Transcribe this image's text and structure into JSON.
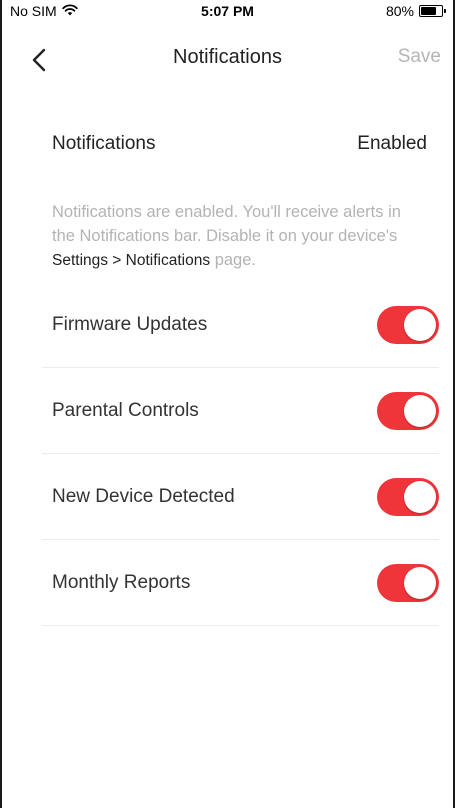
{
  "status_bar": {
    "carrier": "No SIM",
    "time": "5:07 PM",
    "battery_text": "80%",
    "battery_level": 0.8
  },
  "nav": {
    "title": "Notifications",
    "save_label": "Save"
  },
  "summary": {
    "label": "Notifications",
    "value": "Enabled"
  },
  "info": {
    "text_before": "Notifications are enabled. You'll receive alerts in the Notifications bar. Disable it on your device's",
    "path": "Settings > Notifications",
    "text_after": "page."
  },
  "settings": [
    {
      "label": "Firmware Updates",
      "enabled": true
    },
    {
      "label": "Parental Controls",
      "enabled": true
    },
    {
      "label": "New Device Detected",
      "enabled": true
    },
    {
      "label": "Monthly Reports",
      "enabled": true
    }
  ],
  "colors": {
    "toggle_on": "#f0353a",
    "muted_text": "#b3b3b3",
    "save_disabled": "#b5b5b5"
  }
}
